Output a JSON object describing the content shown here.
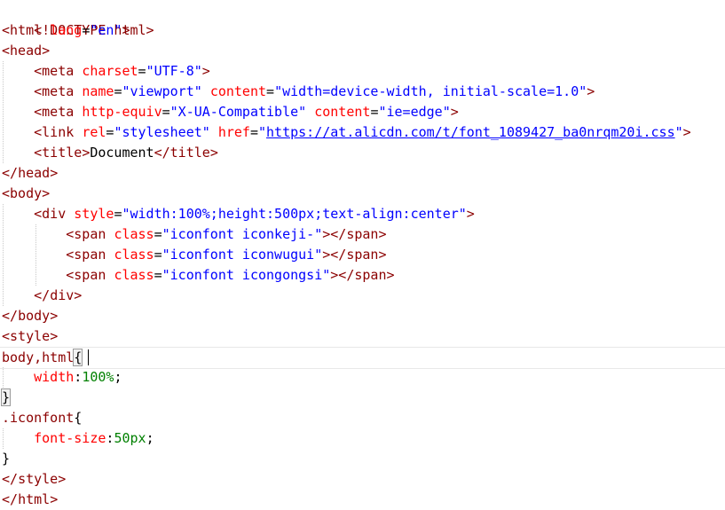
{
  "editor": {
    "language": "html",
    "lines": [
      "<!DOCTYPE html>",
      "<html lang=\"en\">",
      "<head>",
      "    <meta charset=\"UTF-8\">",
      "    <meta name=\"viewport\" content=\"width=device-width, initial-scale=1.0\">",
      "    <meta http-equiv=\"X-UA-Compatible\" content=\"ie=edge\">",
      "    <link rel=\"stylesheet\" href=\"https://at.alicdn.com/t/font_1089427_ba0nrqm20i.css\">",
      "    <title>Document</title>",
      "</head>",
      "<body>",
      "    <div style=\"width:100%;height:500px;text-align:center\">",
      "        <span class=\"iconfont iconkeji-\"></span>",
      "        <span class=\"iconfont iconwugui\"></span>",
      "        <span class=\"iconfont icongongsi\"></span>",
      "    </div>",
      "</body>",
      "<style>",
      "body,html{",
      "    width:100%;",
      "}",
      ".iconfont{",
      "    font-size:50px;",
      "}",
      "</style>",
      "</html>"
    ],
    "current_line": 18,
    "colors": {
      "tag": "#8b0000",
      "attribute": "#ff0000",
      "string": "#0000ff",
      "css_value": "#008000",
      "text": "#000000",
      "background": "#ffffff"
    }
  }
}
